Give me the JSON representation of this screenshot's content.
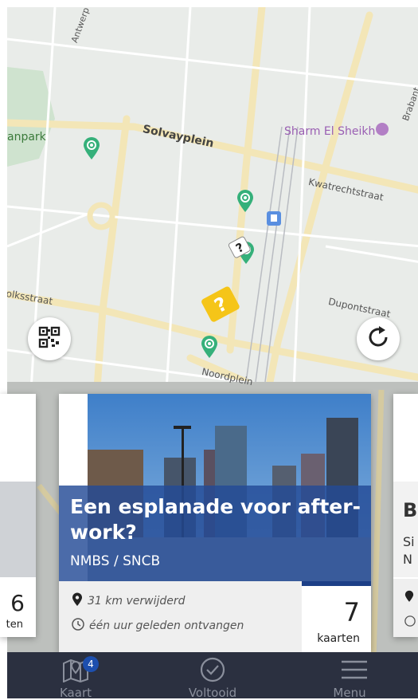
{
  "map": {
    "labels": {
      "park": "anpark",
      "solvay": "Solvayplein",
      "poi": "Sharm El Sheikh",
      "kwatrecht": "Kwatrechtstraat",
      "volks": "olksstraat",
      "dupont": "Dupontstraat",
      "noord": "Noordplein",
      "antwerp": "Antwerp",
      "braban": "Brabant"
    },
    "colors": {
      "road": "#f3e6b7",
      "block": "#dfe3df",
      "pin": "#35b07a",
      "quest": "#f5c518"
    }
  },
  "buttons": {
    "qr_icon": "qr-scan-icon",
    "refresh_icon": "refresh-icon"
  },
  "cards": {
    "main": {
      "title": "Een esplanade voor after-work?",
      "subtitle": "NMBS / SNCB",
      "distance": "31 km verwijderd",
      "received": "één uur geleden ontvangen",
      "count": "7",
      "count_label": "kaarten"
    },
    "left": {
      "count": "6",
      "count_label": "ten"
    },
    "right": {
      "title": "B",
      "line1": "Si",
      "line2": "N"
    }
  },
  "tabbar": {
    "tabs": [
      {
        "label": "Kaart",
        "icon": "map-icon",
        "badge": "4"
      },
      {
        "label": "Voltooid",
        "icon": "check-circle-icon"
      },
      {
        "label": "Menu",
        "icon": "menu-icon"
      }
    ],
    "colors": {
      "background": "#2b3040",
      "badge": "#1d4fae"
    }
  }
}
